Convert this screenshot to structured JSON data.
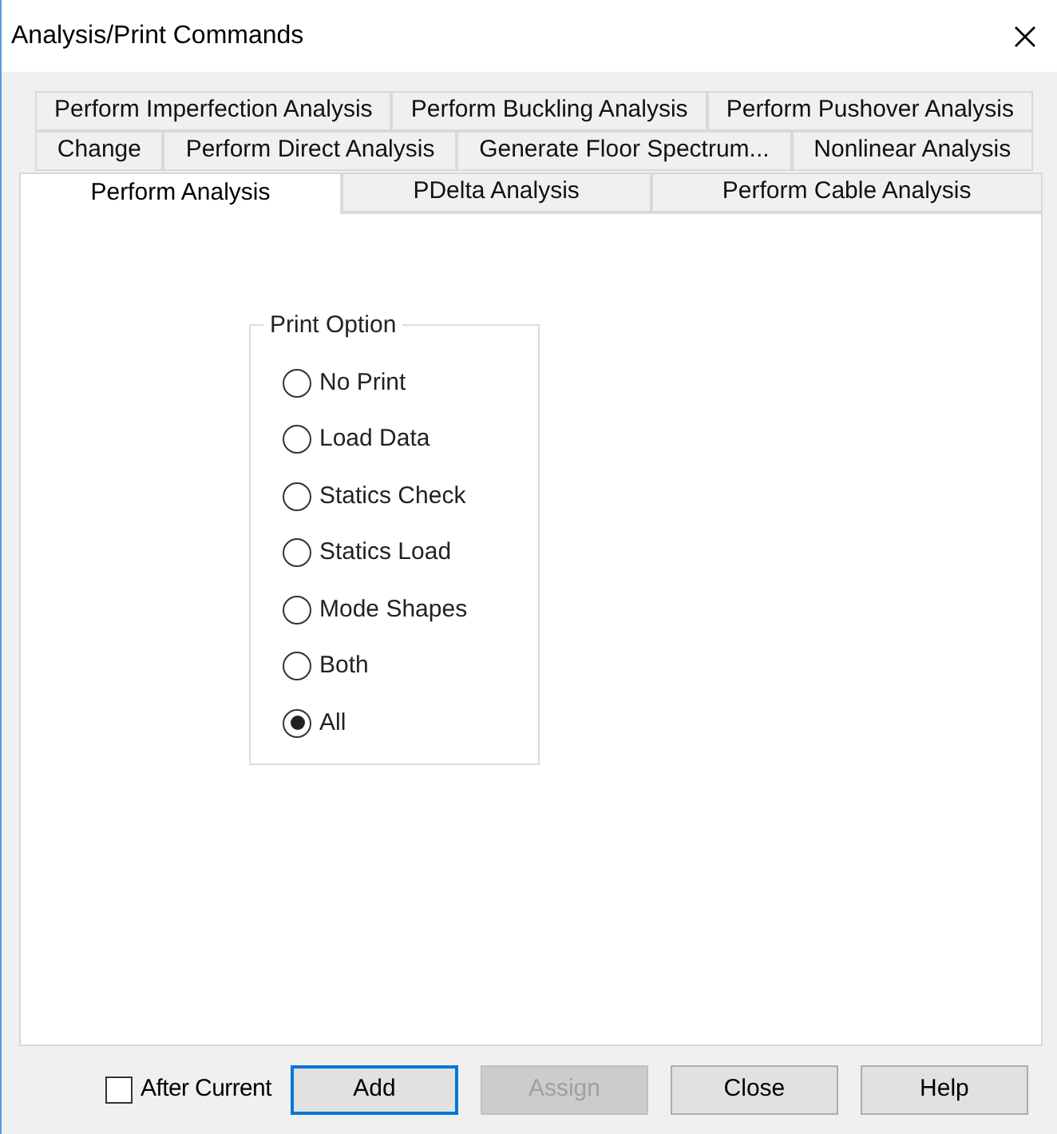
{
  "window": {
    "title": "Analysis/Print Commands"
  },
  "tab_rows": [
    [
      {
        "label": "Perform Imperfection Analysis",
        "selected": false
      },
      {
        "label": "Perform Buckling Analysis",
        "selected": false
      },
      {
        "label": "Perform Pushover Analysis",
        "selected": false
      }
    ],
    [
      {
        "label": "Change",
        "selected": false
      },
      {
        "label": "Perform Direct Analysis",
        "selected": false
      },
      {
        "label": "Generate Floor Spectrum...",
        "selected": false
      },
      {
        "label": "Nonlinear Analysis",
        "selected": false
      }
    ],
    [
      {
        "label": "Perform Analysis",
        "selected": true
      },
      {
        "label": "PDelta Analysis",
        "selected": false
      },
      {
        "label": "Perform Cable Analysis",
        "selected": false
      }
    ]
  ],
  "print_option": {
    "title": "Print Option",
    "options": [
      {
        "label": "No Print",
        "selected": false
      },
      {
        "label": "Load Data",
        "selected": false
      },
      {
        "label": "Statics Check",
        "selected": false
      },
      {
        "label": "Statics Load",
        "selected": false
      },
      {
        "label": "Mode Shapes",
        "selected": false
      },
      {
        "label": "Both",
        "selected": false
      },
      {
        "label": "All",
        "selected": true
      }
    ]
  },
  "after_current": {
    "label": "After Current",
    "checked": false
  },
  "buttons": [
    {
      "label": "Add",
      "disabled": false,
      "focused": true
    },
    {
      "label": "Assign",
      "disabled": true,
      "focused": false
    },
    {
      "label": "Close",
      "disabled": false,
      "focused": false
    },
    {
      "label": "Help",
      "disabled": false,
      "focused": false
    }
  ]
}
